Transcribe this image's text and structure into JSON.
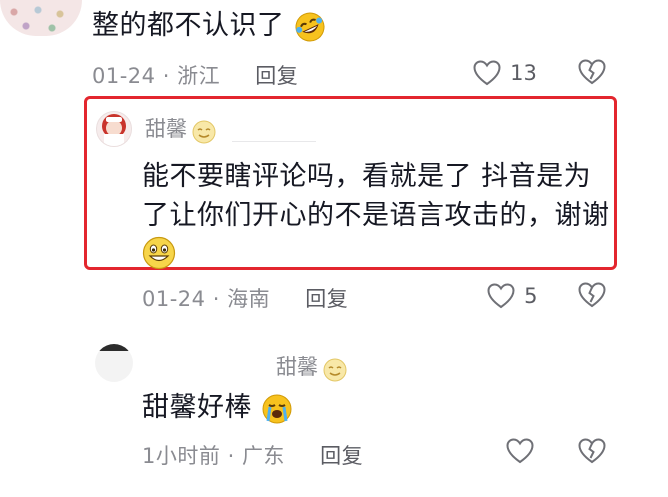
{
  "comments": [
    {
      "text": "整的都不认识了",
      "emoji": "rolling-laughing-emoji",
      "date": "01-24",
      "sep": "·",
      "location": "浙江",
      "reply_label": "回复",
      "likes": "13"
    },
    {
      "username": "甜馨",
      "username_emoji": "smile-emoji",
      "text_line1": "能不要瞎评论吗，看就是了 抖音是为",
      "text_line2": "了让你们开心的不是语言攻击的，谢谢",
      "emoji": "grinning-emoji",
      "date": "01-24",
      "sep": "·",
      "location": "海南",
      "reply_label": "回复",
      "likes": "5"
    },
    {
      "username": "甜馨",
      "username_emoji": "smile-emoji",
      "text": "甜馨好棒",
      "emoji": "crying-emoji",
      "time": "1小时前",
      "sep": "·",
      "location": "广东",
      "reply_label": "回复",
      "likes": ""
    }
  ],
  "colors": {
    "highlight_border": "#e3262e",
    "text": "#161823",
    "meta": "#8a8b91"
  }
}
